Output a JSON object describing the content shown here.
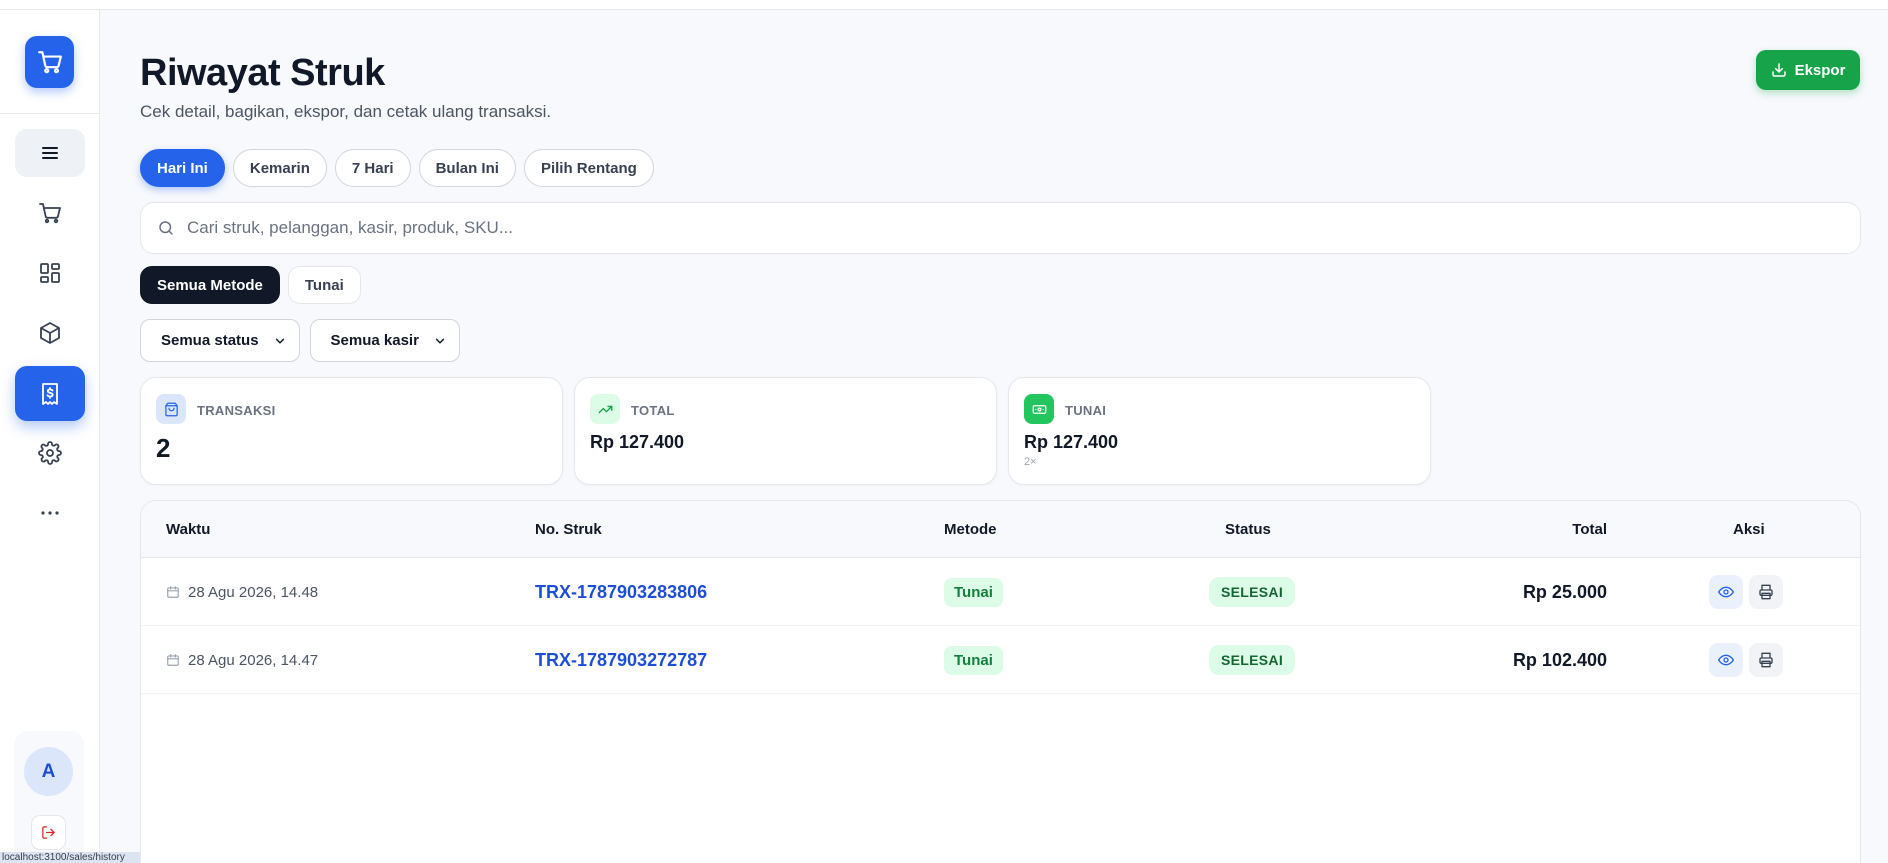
{
  "page": {
    "title": "Riwayat Struk",
    "subtitle": "Cek detail, bagikan, ekspor, dan cetak ulang transaksi.",
    "export_label": "Ekspor"
  },
  "date_filters": [
    "Hari Ini",
    "Kemarin",
    "7 Hari",
    "Bulan Ini",
    "Pilih Rentang"
  ],
  "date_filter_active": "Hari Ini",
  "search": {
    "placeholder": "Cari struk, pelanggan, kasir, produk, SKU...",
    "value": ""
  },
  "methods": [
    "Semua Metode",
    "Tunai"
  ],
  "method_active": "Semua Metode",
  "selects": {
    "status": "Semua status",
    "cashier": "Semua kasir"
  },
  "stats": {
    "transactions": {
      "label": "TRANSAKSI",
      "value": "2"
    },
    "total": {
      "label": "TOTAL",
      "value": "Rp 127.400"
    },
    "cash": {
      "label": "TUNAI",
      "value": "Rp 127.400",
      "sub": "2×"
    }
  },
  "table": {
    "headers": [
      "Waktu",
      "No. Struk",
      "Metode",
      "Status",
      "Total",
      "Aksi"
    ],
    "rows": [
      {
        "time": "28 Agu 2026, 14.48",
        "id": "TRX-1787903283806",
        "method": "Tunai",
        "status": "SELESAI",
        "total": "Rp 25.000"
      },
      {
        "time": "28 Agu 2026, 14.47",
        "id": "TRX-1787903272787",
        "method": "Tunai",
        "status": "SELESAI",
        "total": "Rp 102.400"
      }
    ]
  },
  "sidebar": {
    "avatar_initial": "A",
    "items": [
      "menu-icon",
      "cart-icon",
      "dashboard-icon",
      "box-icon",
      "receipt-icon",
      "settings-icon",
      "more-icon"
    ],
    "active": "receipt-icon"
  },
  "status_bar": {
    "url": "localhost:3100/sales/history"
  },
  "colors": {
    "primary": "#2563eb",
    "success": "#16a34a",
    "dark": "#111827"
  }
}
